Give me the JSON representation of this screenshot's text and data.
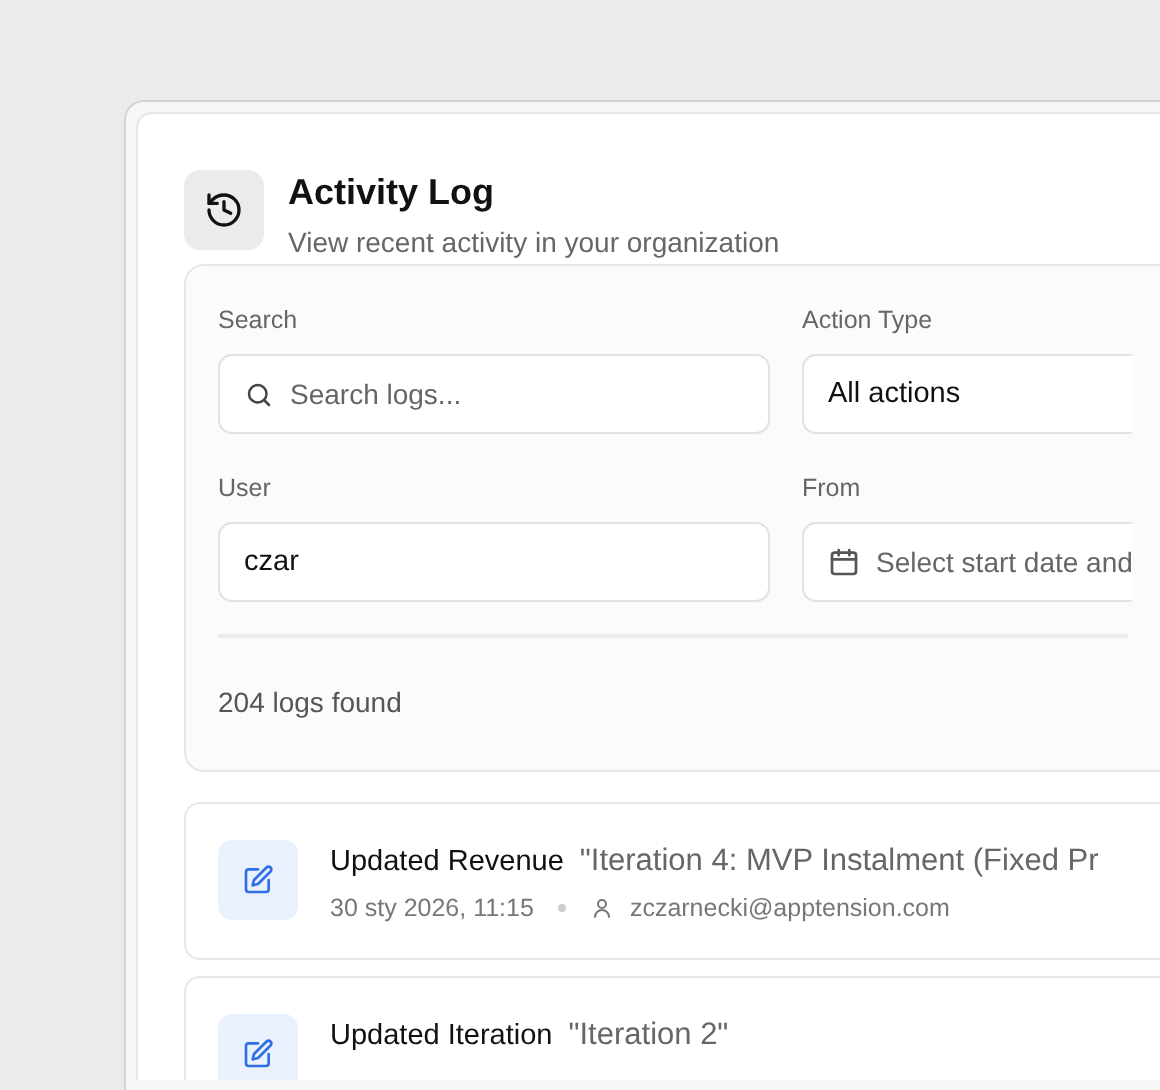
{
  "header": {
    "title": "Activity Log",
    "subtitle": "View recent activity in your organization"
  },
  "filters": [
    {
      "label": "Search",
      "kind": "search",
      "placeholder": "Search logs..."
    },
    {
      "label": "Action Type",
      "kind": "select",
      "value": "All actions"
    },
    {
      "label": "User",
      "kind": "text",
      "value": "czar"
    },
    {
      "label": "From",
      "kind": "date",
      "placeholder": "Select start date and"
    }
  ],
  "results_count": "204 logs found",
  "logs": [
    {
      "action": "Updated Revenue",
      "target": "\"Iteration 4: MVP Instalment (Fixed Pr",
      "time": "30 sty 2026, 11:15",
      "user": "zczarnecki@apptension.com"
    },
    {
      "action": "Updated Iteration",
      "target": "\"Iteration 2\""
    }
  ]
}
